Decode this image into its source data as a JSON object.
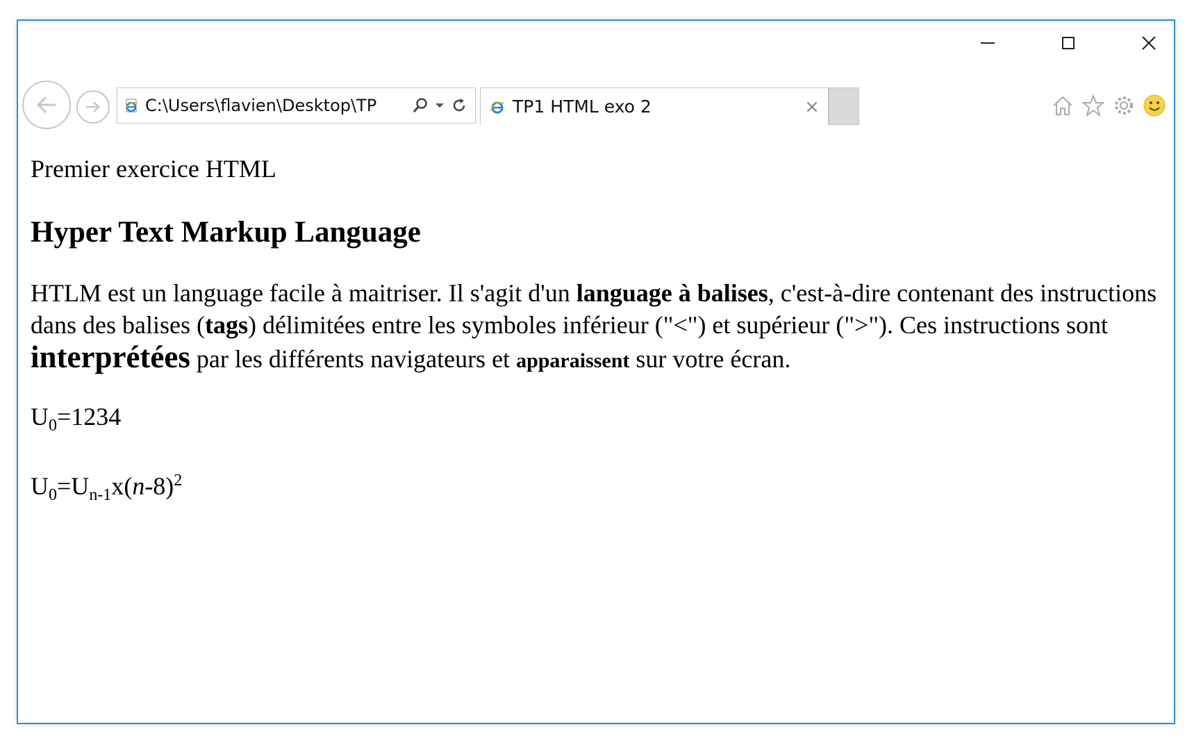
{
  "window": {
    "controls": {
      "minimize": "minimize-icon",
      "maximize": "maximize-icon",
      "close": "close-icon"
    }
  },
  "navbar": {
    "address": "C:\\Users\\flavien\\Desktop\\TP",
    "tab_title": "TP1 HTML exo 2",
    "tab_close": "×"
  },
  "page": {
    "intro": "Premier exercice HTML",
    "heading": "Hyper Text Markup Language",
    "para": {
      "t1": "HTLM est un language facile à maitriser. Il s'agit d'un ",
      "b1": "language à balises",
      "t2": ", c'est-à-dire contenant des instructions dans des balises (",
      "b2": "tags",
      "t3": ") délimitées entre les symboles inférieur (\"<\") et supérieur (\">\"). Ces instructions sont ",
      "big": "interprétées",
      "t4": " par les différents navigateurs et ",
      "small": "apparaissent",
      "t5": " sur votre écran."
    },
    "formula1": {
      "base": "U",
      "sub": "0",
      "rest": "=1234"
    },
    "formula2": {
      "base": "U",
      "sub": "0",
      "eq": "=U",
      "sub2": "n-1",
      "mid": "x(",
      "italic": "n",
      "tail": "-8)",
      "sup": "2"
    }
  }
}
